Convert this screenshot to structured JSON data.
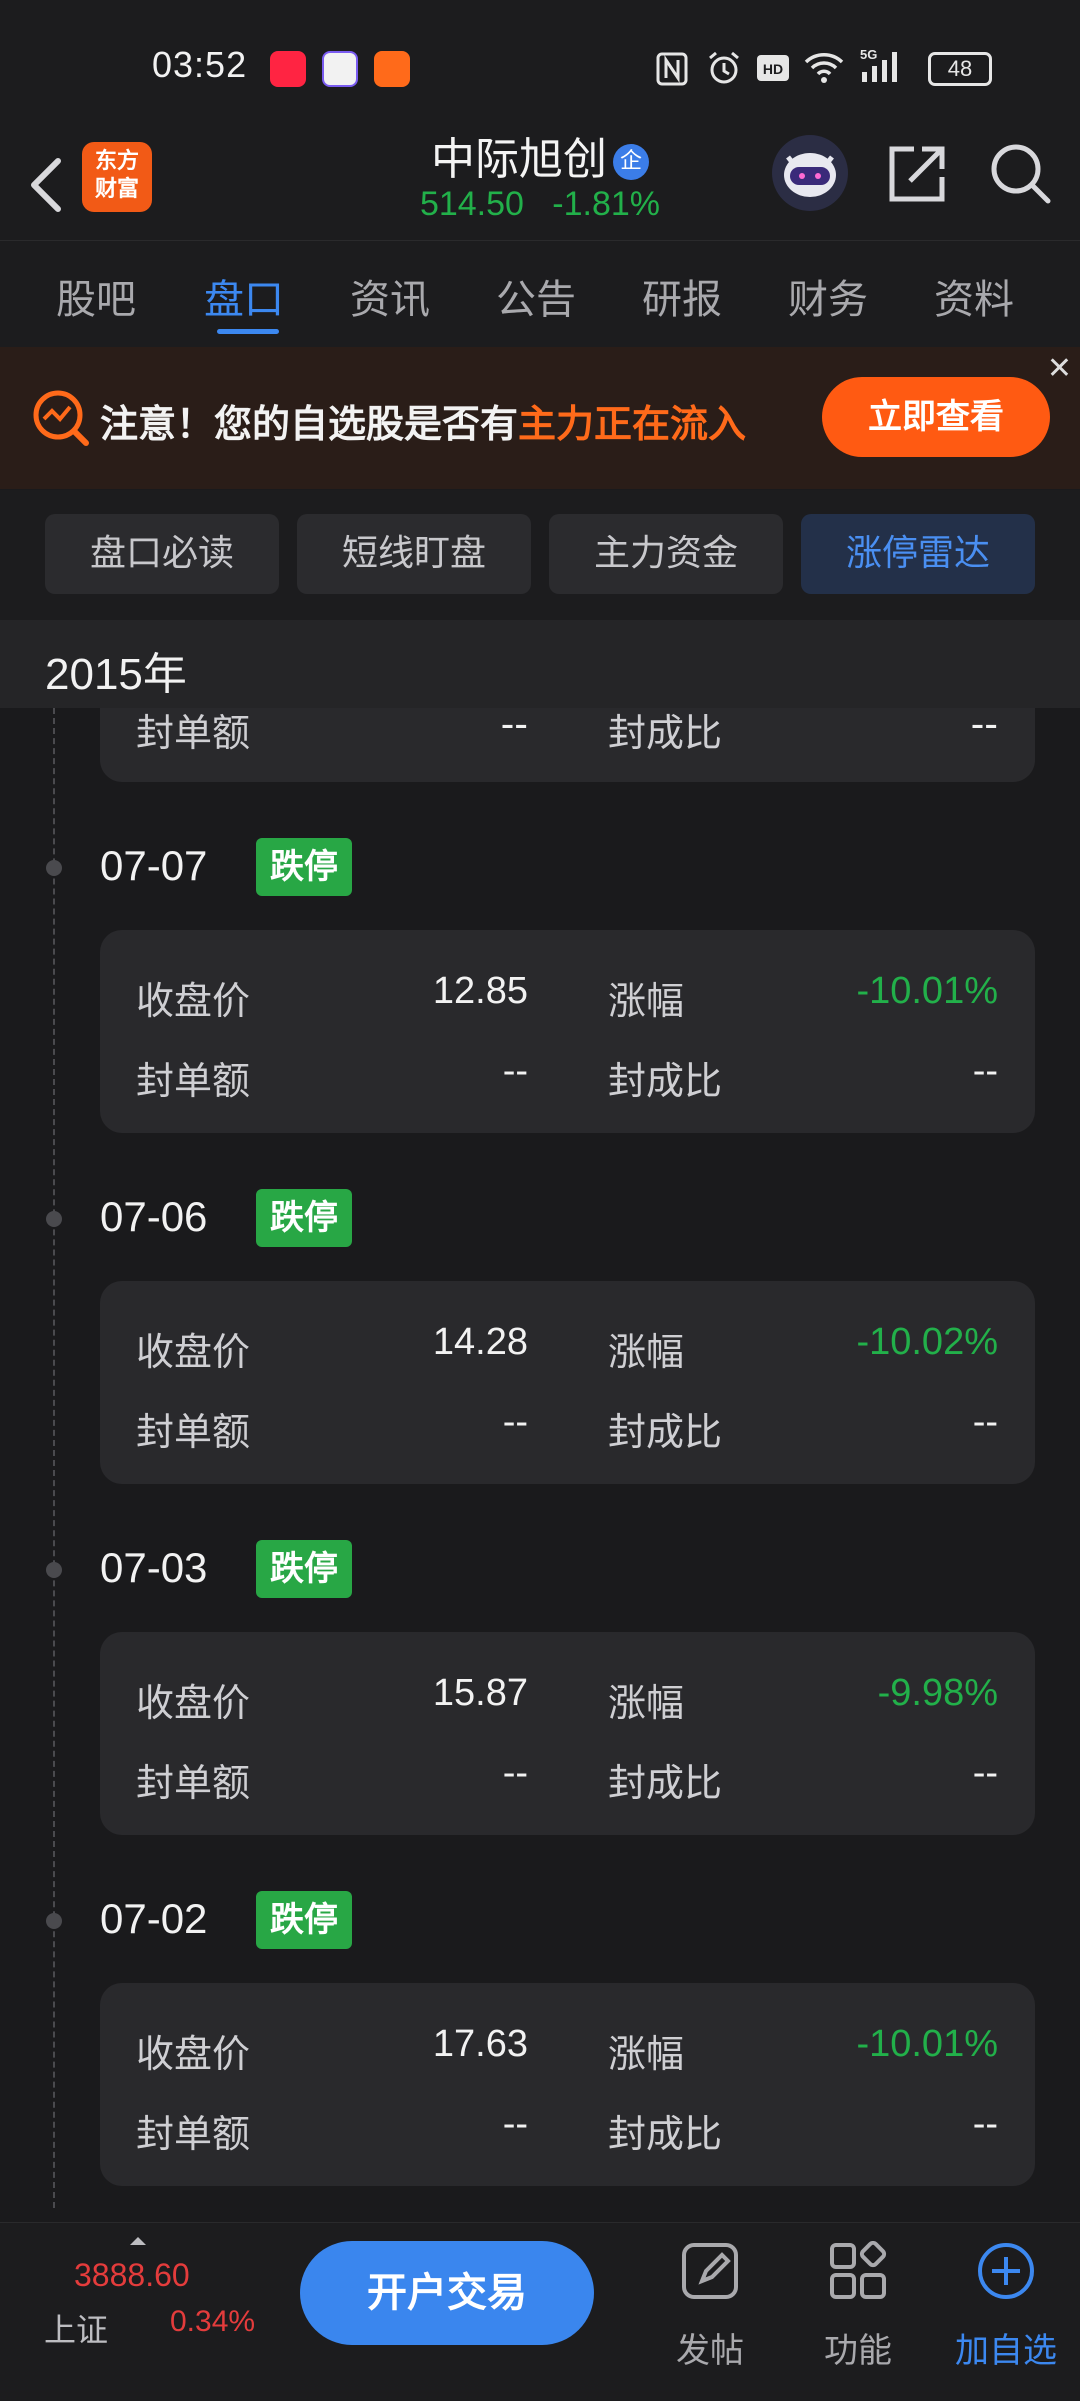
{
  "status_bar": {
    "time": "03:52",
    "app_icons": [
      "xiaohongshu-icon",
      "colorful-app-icon",
      "coin-app-icon"
    ],
    "battery": "48",
    "sys_icons": [
      "nfc-icon",
      "alarm-icon",
      "hd-icon",
      "wifi-icon",
      "5g-signal-icon"
    ]
  },
  "header": {
    "app_logo": "东方\n财富",
    "stock_name": "中际旭创",
    "badge": "企",
    "price": "514.50",
    "change": "-1.81%"
  },
  "tabs": [
    "股吧",
    "盘口",
    "资讯",
    "公告",
    "研报",
    "财务",
    "资料"
  ],
  "active_tab": "盘口",
  "banner": {
    "text_prefix": "注意！您的自选股是否有",
    "text_highlight": "主力正在流入",
    "cta": "立即查看",
    "close": "✕"
  },
  "subtabs": [
    "盘口必读",
    "短线盯盘",
    "主力资金",
    "涨停雷达"
  ],
  "active_subtab": "涨停雷达",
  "year": "2015年",
  "partial_card": {
    "label1": "封单额",
    "value1": "--",
    "label2": "封成比",
    "value2": "--"
  },
  "entries": [
    {
      "date": "07-07",
      "tag": "跌停",
      "close_label": "收盘价",
      "close": "12.85",
      "chg_label": "涨幅",
      "chg": "-10.01%",
      "seal_label": "封单额",
      "seal": "--",
      "ratio_label": "封成比",
      "ratio": "--"
    },
    {
      "date": "07-06",
      "tag": "跌停",
      "close_label": "收盘价",
      "close": "14.28",
      "chg_label": "涨幅",
      "chg": "-10.02%",
      "seal_label": "封单额",
      "seal": "--",
      "ratio_label": "封成比",
      "ratio": "--"
    },
    {
      "date": "07-03",
      "tag": "跌停",
      "close_label": "收盘价",
      "close": "15.87",
      "chg_label": "涨幅",
      "chg": "-9.98%",
      "seal_label": "封单额",
      "seal": "--",
      "ratio_label": "封成比",
      "ratio": "--"
    },
    {
      "date": "07-02",
      "tag": "跌停",
      "close_label": "收盘价",
      "close": "17.63",
      "chg_label": "涨幅",
      "chg": "-10.01%",
      "seal_label": "封单额",
      "seal": "--",
      "ratio_label": "封成比",
      "ratio": "--"
    }
  ],
  "bottom_bar": {
    "index_value": "3888.60",
    "index_name": "上证",
    "index_change": "0.34%",
    "trade_button": "开户交易",
    "nav": [
      "发帖",
      "功能",
      "加自选"
    ]
  },
  "colors": {
    "accent": "#3c88f0",
    "down": "#22b04a",
    "up": "#e43c3c",
    "orange": "#ff5a12"
  }
}
